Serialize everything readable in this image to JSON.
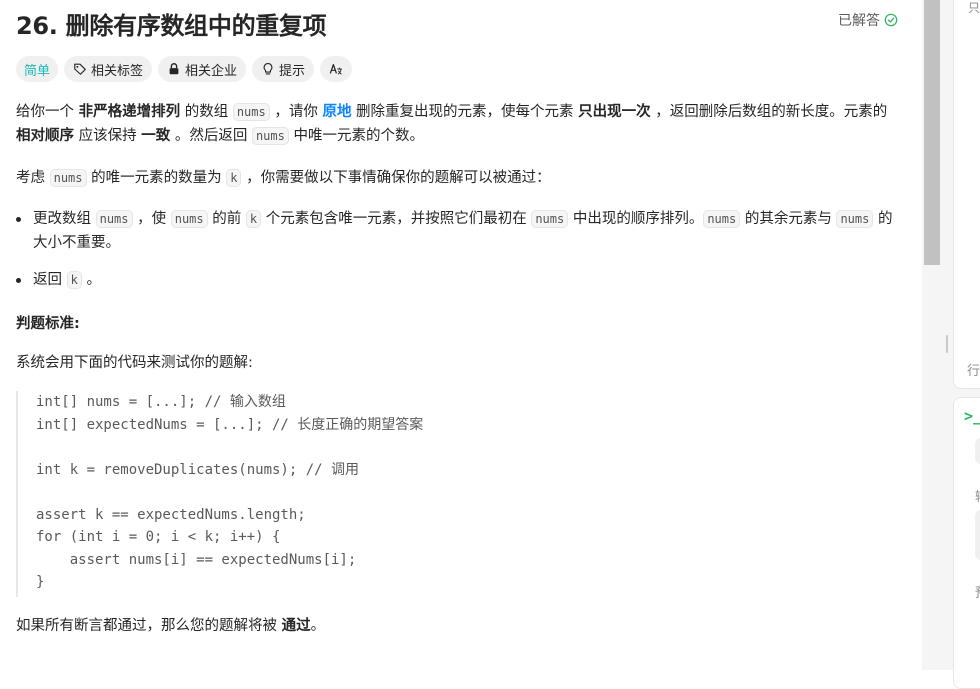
{
  "problem": {
    "title": "26. 删除有序数组中的重复项",
    "status": "已解答",
    "tags": [
      {
        "label": "简单",
        "icon": ""
      },
      {
        "label": "相关标签",
        "icon": "tag-icon"
      },
      {
        "label": "相关企业",
        "icon": "lock-icon"
      },
      {
        "label": "提示",
        "icon": "lightbulb-icon"
      },
      {
        "label": "Aあ",
        "icon": "translate-icon"
      }
    ],
    "p1": {
      "t1": "给你一个 ",
      "b1": "非严格递增排列",
      "t2": " 的数组 ",
      "c1": "nums",
      "t3": " ，请你 ",
      "link": "原地",
      "t4": " 删除重复出现的元素，使每个元素 ",
      "b2": "只出现一次",
      "t5": " ，返回删除后数组的新长度。元素的 ",
      "b3": "相对顺序",
      "t6": " 应该保持 ",
      "b4": "一致",
      "t7": " 。然后返回 ",
      "c2": "nums",
      "t8": " 中唯一元素的个数。"
    },
    "p2": {
      "t1": "考虑 ",
      "c1": "nums",
      "t2": " 的唯一元素的数量为 ",
      "c2": "k",
      "t3": " ，你需要做以下事情确保你的题解可以被通过："
    },
    "bullet1": {
      "t1": "更改数组 ",
      "c1": "nums",
      "t2": " ，使 ",
      "c2": "nums",
      "t3": " 的前 ",
      "c3": "k",
      "t4": " 个元素包含唯一元素，并按照它们最初在 ",
      "c4": "nums",
      "t5": " 中出现的顺序排列。",
      "c5": "nums",
      "t6": " 的其余元素与 ",
      "c6": "nums",
      "t7": " 的大小不重要。"
    },
    "bullet2": {
      "t1": "返回 ",
      "c1": "k",
      "t2": " 。"
    },
    "judge_heading": "判题标准:",
    "judge_intro": "系统会用下面的代码来测试你的题解:",
    "code_lines": [
      "int[] nums = [...]; // 输入数组",
      "int[] expectedNums = [...]; // 长度正确的期望答案",
      "",
      "int k = removeDuplicates(nums); // 调用",
      "",
      "assert k == expectedNums.length;",
      "for (int i = 0; i < k; i++) {",
      "    assert nums[i] == expectedNums[i];",
      "}"
    ],
    "closing": {
      "t1": "如果所有断言都通过，那么您的题解将被 ",
      "b1": "通过",
      "t2": "。"
    }
  },
  "right_panel": {
    "top_glyph": "只",
    "line_label": "行",
    "terminal_glyph": ">_",
    "label_1": "输",
    "label_2": "预"
  },
  "colors": {
    "easy": "#1cb8b8",
    "link": "#0a84ff",
    "solved_check": "#2db55d",
    "terminal": "#2db55d"
  }
}
